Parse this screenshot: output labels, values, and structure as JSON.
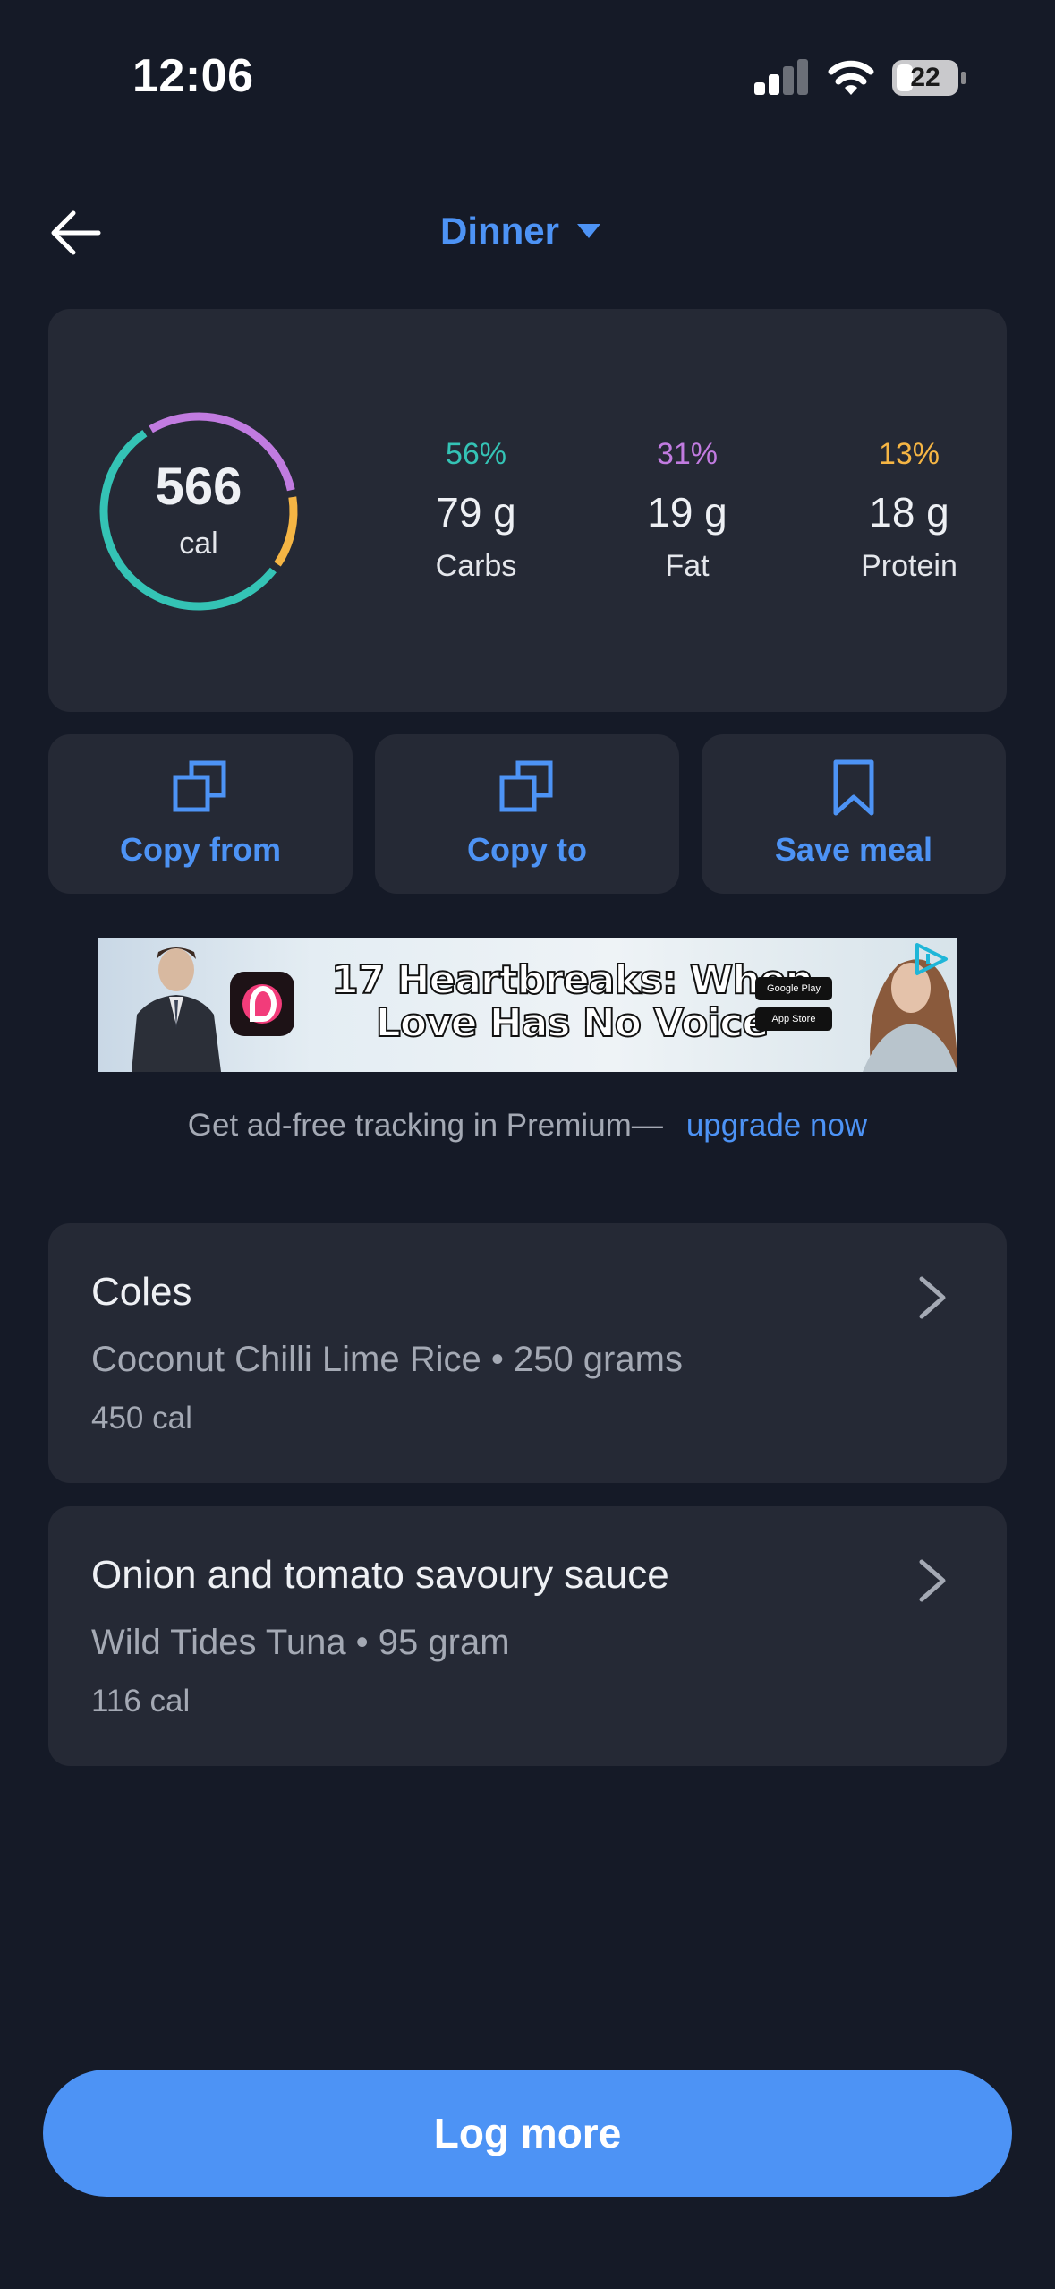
{
  "status_bar": {
    "time": "12:06",
    "battery": "22"
  },
  "header": {
    "meal_name": "Dinner"
  },
  "summary": {
    "calories": "566",
    "cal_unit": "cal",
    "ring_fractions": {
      "carbs": 0.56,
      "fat": 0.31,
      "protein": 0.13
    },
    "macros": [
      {
        "pct": "56%",
        "grams": "79 g",
        "name": "Carbs",
        "color": "#34c3b5"
      },
      {
        "pct": "31%",
        "grams": "19 g",
        "name": "Fat",
        "color": "#c17be0"
      },
      {
        "pct": "13%",
        "grams": "18 g",
        "name": "Protein",
        "color": "#f5b544"
      }
    ]
  },
  "actions": {
    "copy_from": "Copy from",
    "copy_to": "Copy to",
    "save_meal": "Save meal"
  },
  "ad": {
    "headline_line1": "17 Heartbreaks: When",
    "headline_line2": "Love Has No Voice",
    "store1": "Google Play",
    "store2": "App Store"
  },
  "premium": {
    "text": "Get ad-free tracking in Premium—",
    "link": "upgrade now"
  },
  "foods": [
    {
      "title": "Coles",
      "detail": "Coconut Chilli Lime Rice • 250 grams",
      "calories": "450 cal"
    },
    {
      "title": "Onion and tomato savoury sauce",
      "detail": "Wild Tides Tuna • 95 gram",
      "calories": "116 cal"
    }
  ],
  "log_more": "Log more",
  "colors": {
    "accent": "#4d93f5",
    "background": "#151a27",
    "card": "#252935"
  }
}
